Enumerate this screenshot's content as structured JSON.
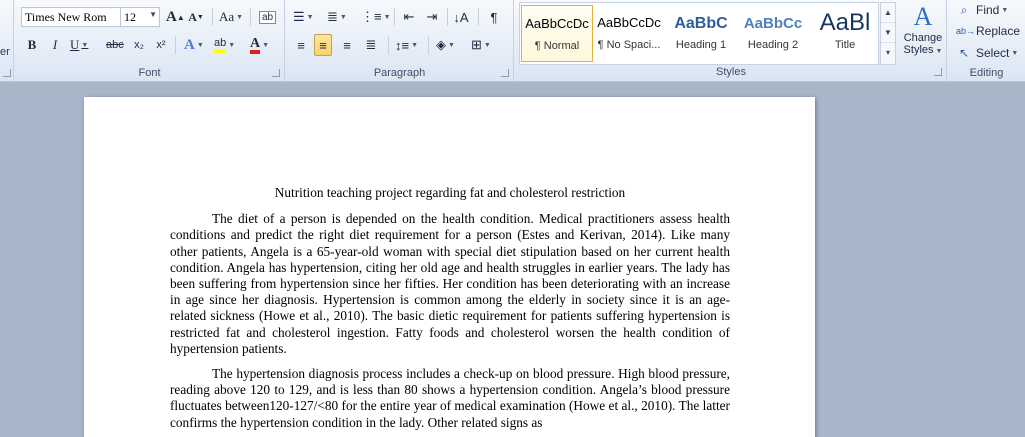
{
  "ribbon": {
    "clipboard_fragment": "er",
    "font": {
      "name": "Times New Rom",
      "size": "12",
      "group_label": "Font",
      "grow_icon": "A",
      "shrink_icon": "A",
      "case_label": "Aa",
      "bold": "B",
      "italic": "I",
      "underline": "U",
      "strike": "abc",
      "subscript": "x₂",
      "superscript": "x²"
    },
    "paragraph": {
      "group_label": "Paragraph",
      "pilcrow": "¶"
    },
    "styles": {
      "group_label": "Styles",
      "items": [
        {
          "preview": "AaBbCcDc",
          "name": "¶ Normal"
        },
        {
          "preview": "AaBbCcDc",
          "name": "¶ No Spaci..."
        },
        {
          "preview": "AaBbC",
          "name": "Heading 1"
        },
        {
          "preview": "AaBbCc",
          "name": "Heading 2"
        },
        {
          "preview": "AaBl",
          "name": "Title"
        }
      ],
      "change_styles_line1": "Change",
      "change_styles_line2": "Styles"
    },
    "editing": {
      "group_label": "Editing",
      "find": "Find",
      "replace": "Replace",
      "select": "Select"
    }
  },
  "document": {
    "title": "Nutrition teaching project regarding fat and cholesterol restriction",
    "paragraphs": [
      "The diet of a person is depended on the health condition. Medical practitioners assess health conditions and predict the right diet requirement for a person (Estes and Kerivan, 2014). Like many other patients, Angela is a 65-year-old woman with special diet stipulation based on her current health condition. Angela has hypertension, citing her old age and health struggles in earlier years. The lady has been suffering from hypertension since her fifties. Her condition has been deteriorating with an increase in age since her diagnosis. Hypertension is common among the elderly in society since it is an age-related sickness (Howe et al., 2010). The basic dietic requirement for patients suffering hypertension is restricted fat and cholesterol ingestion. Fatty foods and cholesterol worsen the health condition of hypertension patients.",
      "The hypertension diagnosis process includes a check-up on blood pressure. High blood pressure, reading above 120 to 129, and is less than 80 shows a hypertension condition. Angela’s blood pressure fluctuates between120-127/<80 for the entire year of medical examination (Howe et al., 2010). The latter confirms the hypertension condition in the lady. Other related signs as"
    ]
  }
}
